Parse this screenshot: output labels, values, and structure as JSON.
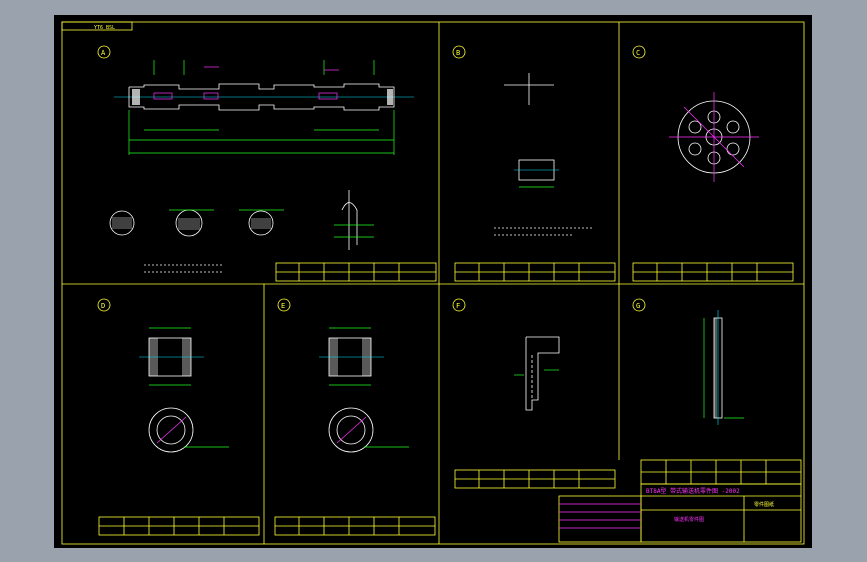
{
  "sheet": {
    "corner_tag": "YT6 BSL",
    "view_labels": [
      "A",
      "B",
      "C",
      "D",
      "E",
      "F",
      "G"
    ]
  },
  "title_block": {
    "main_title": "BT8A型 带式输送机零件图 -2002",
    "drawing_no": "零件图纸",
    "part_name": "输送机零件图"
  },
  "colors": {
    "background": "#000000",
    "frame": "#ffff33",
    "outline": "#ffffff",
    "dimension": "#22ff22",
    "annotation": "#ff33ff",
    "centerline": "#00e5ff"
  }
}
